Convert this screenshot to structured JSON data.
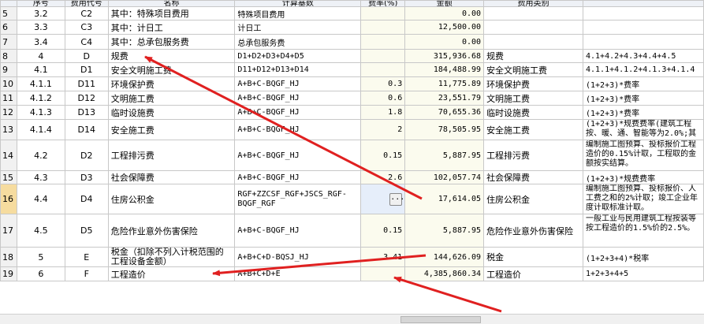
{
  "headers": [
    "",
    "序号",
    "费用代号",
    "名称",
    "计算基数",
    "费率(%)",
    "金额",
    "费用类别",
    ""
  ],
  "rows": [
    {
      "rn": "5",
      "seq": "3.2",
      "code": "C2",
      "name": "其中：特殊项目费用",
      "base": "特殊项目费用",
      "rate": "",
      "amount": "0.00",
      "category": "",
      "note": ""
    },
    {
      "rn": "6",
      "seq": "3.3",
      "code": "C3",
      "name": "其中：计日工",
      "base": "计日工",
      "rate": "",
      "amount": "12,500.00",
      "category": "",
      "note": ""
    },
    {
      "rn": "7",
      "seq": "3.4",
      "code": "C4",
      "name": "其中：总承包服务费",
      "base": "总承包服务费",
      "rate": "",
      "amount": "0.00",
      "category": "",
      "note": ""
    },
    {
      "rn": "8",
      "seq": "4",
      "code": "D",
      "name": "规费",
      "base": "D1+D2+D3+D4+D5",
      "rate": "",
      "amount": "315,936.68",
      "category": "规费",
      "note": "4.1+4.2+4.3+4.4+4.5"
    },
    {
      "rn": "9",
      "seq": "4.1",
      "code": "D1",
      "name": "安全文明施工费",
      "base": "D11+D12+D13+D14",
      "rate": "",
      "amount": "184,488.99",
      "category": "安全文明施工费",
      "note": "4.1.1+4.1.2+4.1.3+4.1.4"
    },
    {
      "rn": "10",
      "seq": "4.1.1",
      "code": "D11",
      "name": "环境保护费",
      "base": "A+B+C-BQGF_HJ",
      "rate": "0.3",
      "amount": "11,775.89",
      "category": "环境保护费",
      "note": "(1+2+3)*费率"
    },
    {
      "rn": "11",
      "seq": "4.1.2",
      "code": "D12",
      "name": "文明施工费",
      "base": "A+B+C-BQGF_HJ",
      "rate": "0.6",
      "amount": "23,551.79",
      "category": "文明施工费",
      "note": "(1+2+3)*费率"
    },
    {
      "rn": "12",
      "seq": "4.1.3",
      "code": "D13",
      "name": "临时设施费",
      "base": "A+B+C-BQGF_HJ",
      "rate": "1.8",
      "amount": "70,655.36",
      "category": "临时设施费",
      "note": "(1+2+3)*费率"
    },
    {
      "rn": "13",
      "seq": "4.1.4",
      "code": "D14",
      "name": "安全施工费",
      "base": "A+B+C-BQGF_HJ",
      "rate": "2",
      "amount": "78,505.95",
      "category": "安全施工费",
      "note": "(1+2+3)*规费费率(建筑工程按、暖、通、智能等为2.0%;其"
    },
    {
      "rn": "14",
      "seq": "4.2",
      "code": "D2",
      "name": "工程排污费",
      "base": "A+B+C-BQGF_HJ",
      "rate": "0.15",
      "amount": "5,887.95",
      "category": "工程排污费",
      "note": "编制施工图预算、投标报价工程造价的0.15%计取，工程取的金额按实结算。"
    },
    {
      "rn": "15",
      "seq": "4.3",
      "code": "D3",
      "name": "社会保障费",
      "base": "A+B+C-BQGF_HJ",
      "rate": "2.6",
      "amount": "102,057.74",
      "category": "社会保障费",
      "note": "(1+2+3)*规费费率"
    },
    {
      "rn": "16",
      "seq": "4.4",
      "code": "D4",
      "name": "住房公积金",
      "base": "RGF+ZZCSF_RGF+JSCS_RGF-BQGF_RGF",
      "rate": "",
      "amount": "17,614.05",
      "category": "住房公积金",
      "note": "编制施工图预算、投标报价、人工费之和的2%计取；竣工企业年度计取标准计取。"
    },
    {
      "rn": "17",
      "seq": "4.5",
      "code": "D5",
      "name": "危险作业意外伤害保险",
      "base": "A+B+C-BQGF_HJ",
      "rate": "0.15",
      "amount": "5,887.95",
      "category": "危险作业意外伤害保险",
      "note": "一般工业与民用建筑工程按装等按工程造价的1.5%价的2.5%。"
    },
    {
      "rn": "18",
      "seq": "5",
      "code": "E",
      "name": "税金（扣除不列入计税范围的工程设备金额）",
      "base": "A+B+C+D-BQSJ_HJ",
      "rate": "3.41",
      "amount": "144,626.09",
      "category": "税金",
      "note": "(1+2+3+4)*税率"
    },
    {
      "rn": "19",
      "seq": "6",
      "code": "F",
      "name": "工程造价",
      "base": "A+B+C+D+E",
      "rate": "",
      "amount": "4,385,860.34",
      "category": "工程造价",
      "note": "1+2+3+4+5"
    }
  ],
  "edit_button_label": "...",
  "colors": {
    "annotation_arrow": "#e02020",
    "selected_row_number": "#f6dc9f",
    "header_bg": "#eef1f6"
  }
}
